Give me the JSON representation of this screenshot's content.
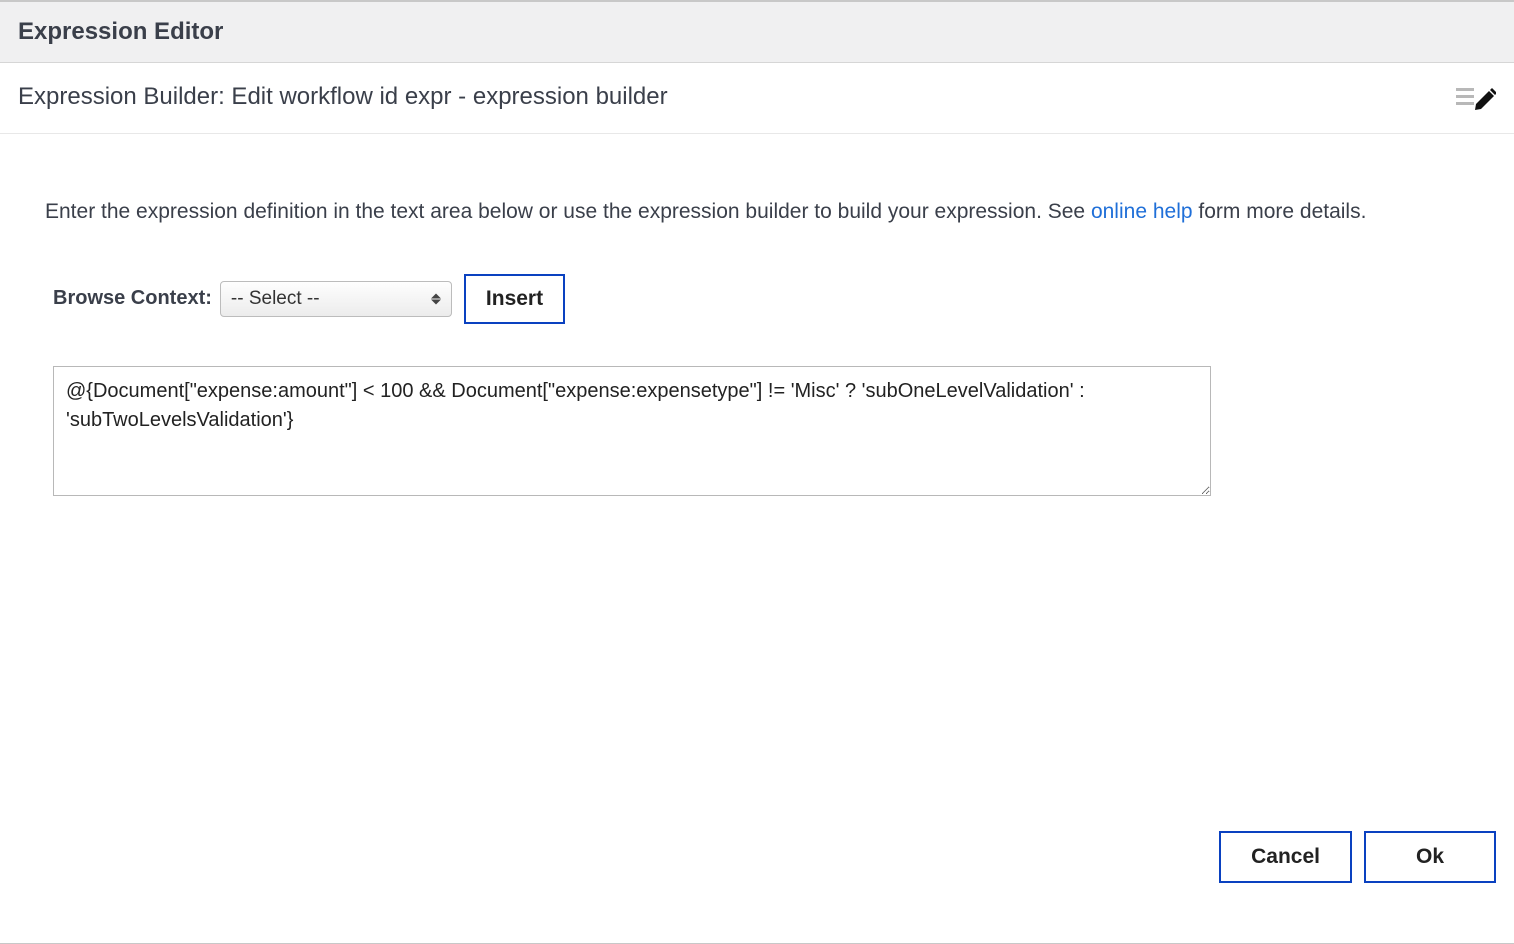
{
  "header": {
    "title": "Expression Editor"
  },
  "subheader": {
    "title": "Expression Builder: Edit workflow id expr - expression builder"
  },
  "instructions": {
    "text_before": "Enter the expression definition in the text area below or use the expression builder to build your expression. See ",
    "link_text": "online help",
    "text_after": " form more details."
  },
  "context": {
    "label": "Browse Context:",
    "selected": "-- Select --",
    "insert_label": "Insert"
  },
  "expression": {
    "value": "@{Document[\"expense:amount\"] < 100 && Document[\"expense:expensetype\"] != 'Misc' ? 'subOneLevelValidation' : 'subTwoLevelsValidation'}"
  },
  "footer": {
    "cancel": "Cancel",
    "ok": "Ok"
  }
}
